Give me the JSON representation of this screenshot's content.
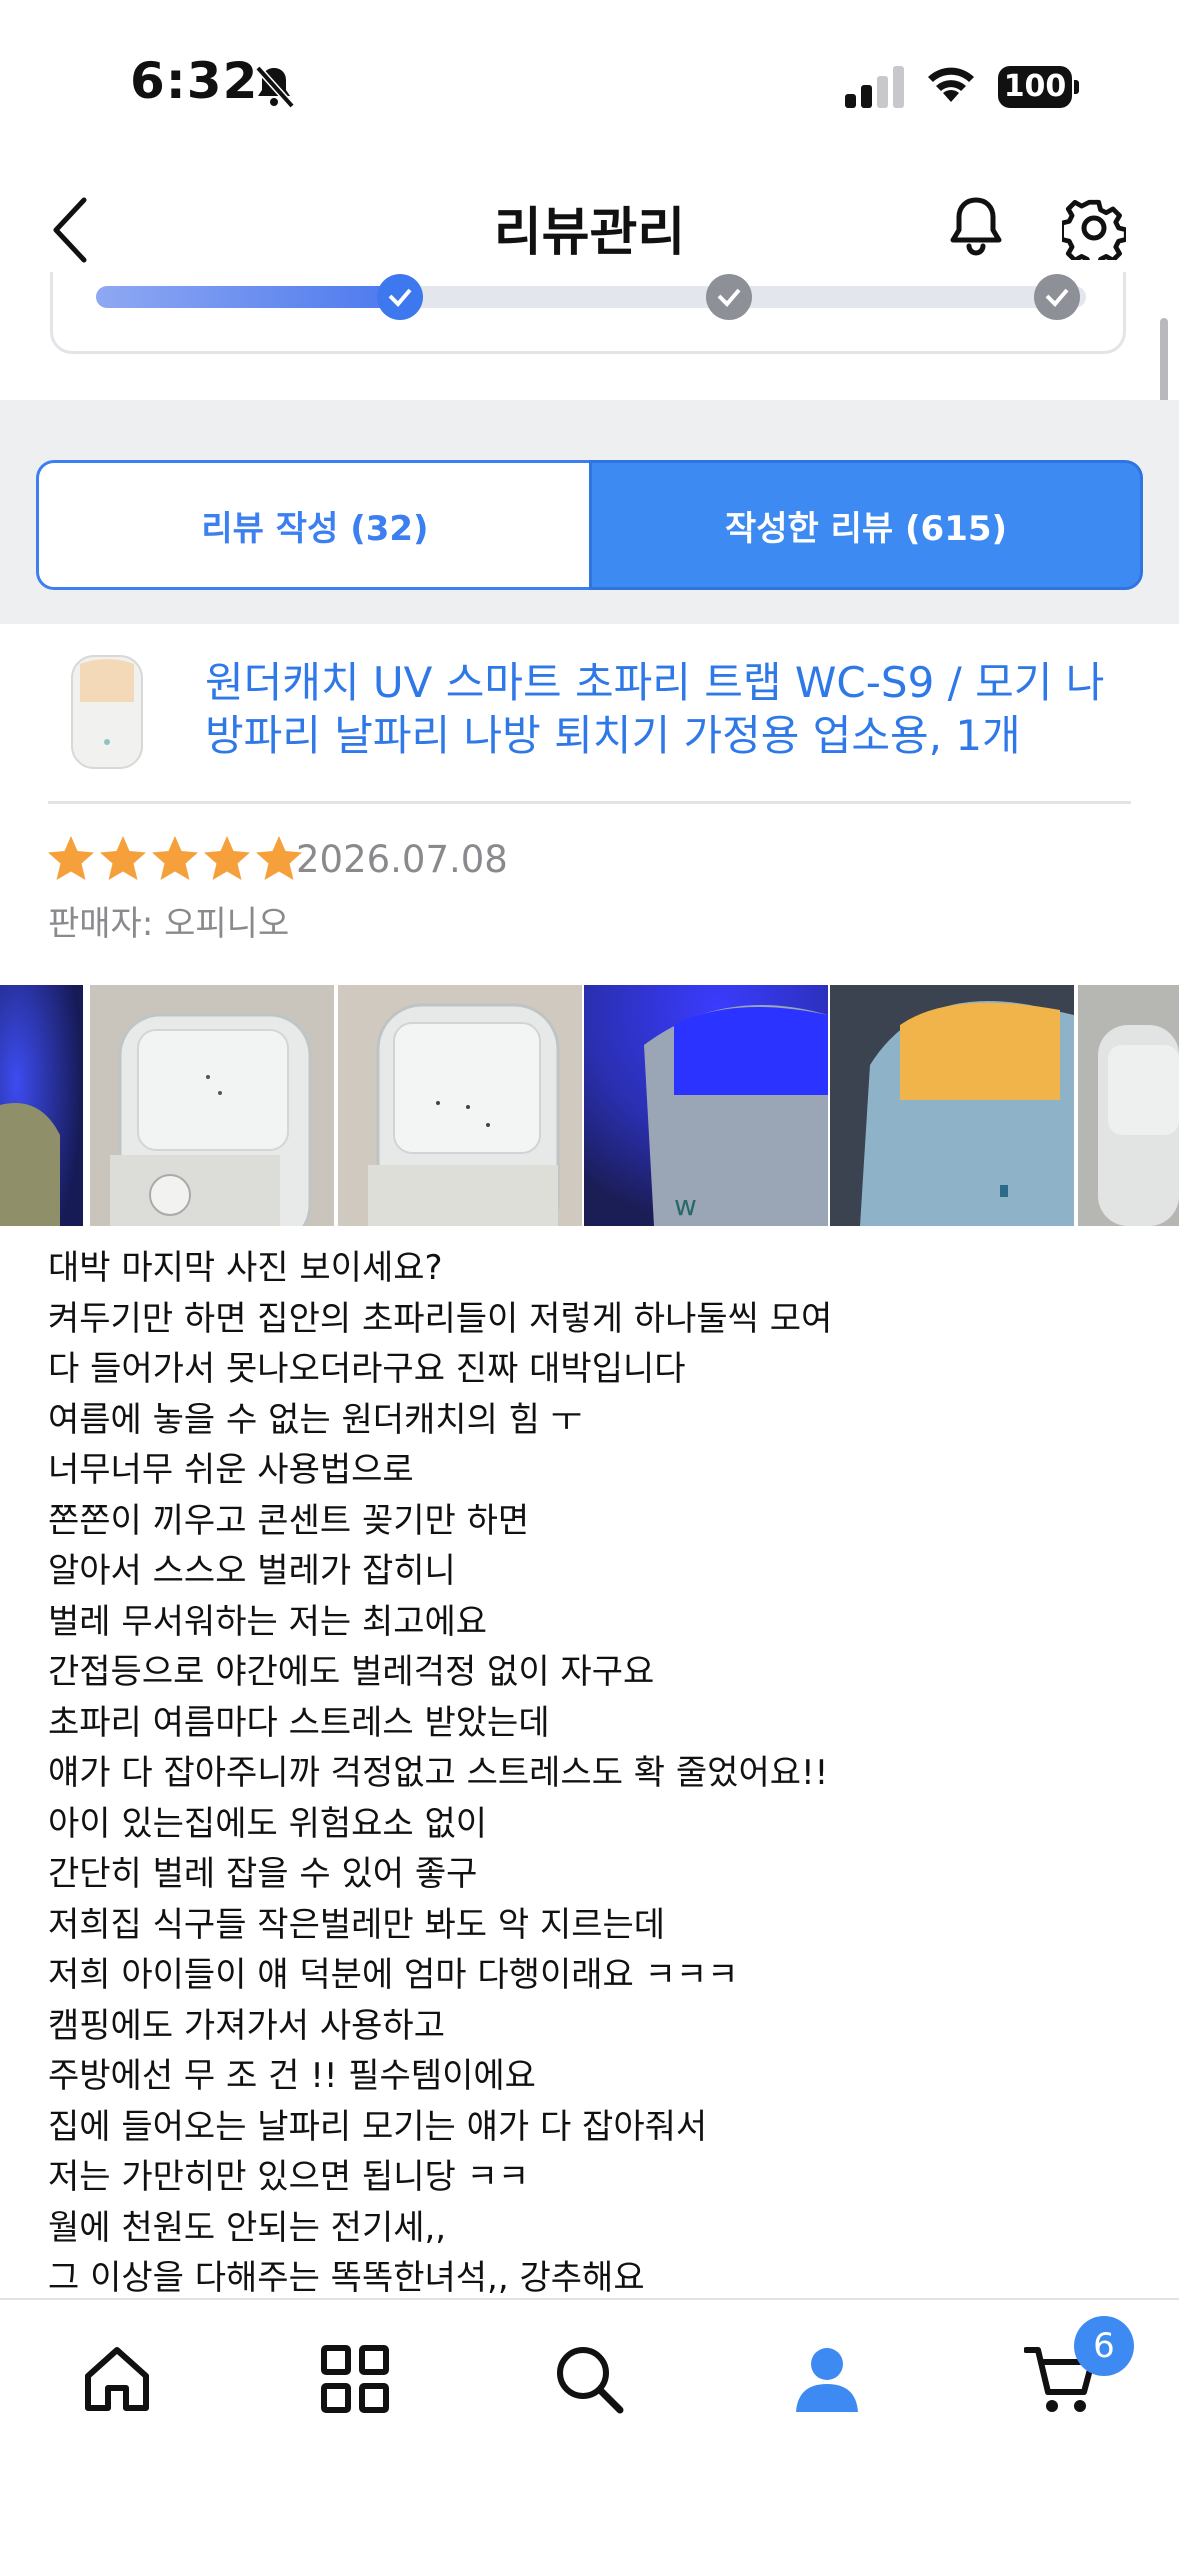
{
  "status_bar": {
    "time": "6:32",
    "battery": "100"
  },
  "header": {
    "title": "리뷰관리"
  },
  "tabs": [
    {
      "label": "리뷰 작성 (32)",
      "active": false
    },
    {
      "label": "작성한 리뷰 (615)",
      "active": true
    }
  ],
  "review": {
    "product_name": "원더캐치 UV 스마트 초파리 트랩 WC-S9 / 모기 나방파리 날파리 나방 퇴치기 가정용 업소용, 1개",
    "rating": 5,
    "date": "2026.07.08",
    "seller": "판매자: 오피니오",
    "photo_count": 6,
    "text_lines": [
      "대박 마지막 사진 보이세요?",
      "켜두기만 하면 집안의 초파리들이 저렇게 하나둘씩 모여",
      "다 들어가서 못나오더라구요 진짜 대박입니다",
      "여름에 놓을 수 없는 원더캐치의 힘 ㅜ",
      "너무너무 쉬운 사용법으로",
      "쫀쫀이 끼우고 콘센트 꽂기만 하면",
      "알아서 스스오 벌레가 잡히니",
      "벌레 무서워하는 저는 최고에요",
      "간접등으로 야간에도 벌레걱정 없이 자구요",
      "초파리 여름마다 스트레스 받았는데",
      "얘가 다 잡아주니까 걱정없고 스트레스도 확 줄었어요!!",
      "아이 있는집에도 위험요소 없이",
      "간단히 벌레 잡을 수 있어 좋구",
      "저희집 식구들 작은벌레만 봐도 악 지르는데",
      "저희 아이들이 얘 덕분에 엄마 다행이래요 ㅋㅋㅋ",
      "캠핑에도 가져가서 사용하고",
      "주방에선 무 조 건 !! 필수템이에요",
      "집에 들어오는 날파리 모기는 얘가 다 잡아줘서",
      "저는 가만히만 있으면 됩니당 ㅋㅋ",
      "월에 천원도 안되는 전기세,,",
      "그 이상을 다해주는 똑똑한녀석,, 강추해요"
    ]
  },
  "bottom_nav": {
    "items": [
      "home-icon",
      "category-grid-icon",
      "search-icon",
      "account-icon",
      "cart-icon"
    ],
    "cart_badge": "6"
  },
  "colors": {
    "accent": "#3d8bf2",
    "star": "#f5a03a",
    "link": "#2f78e8"
  }
}
